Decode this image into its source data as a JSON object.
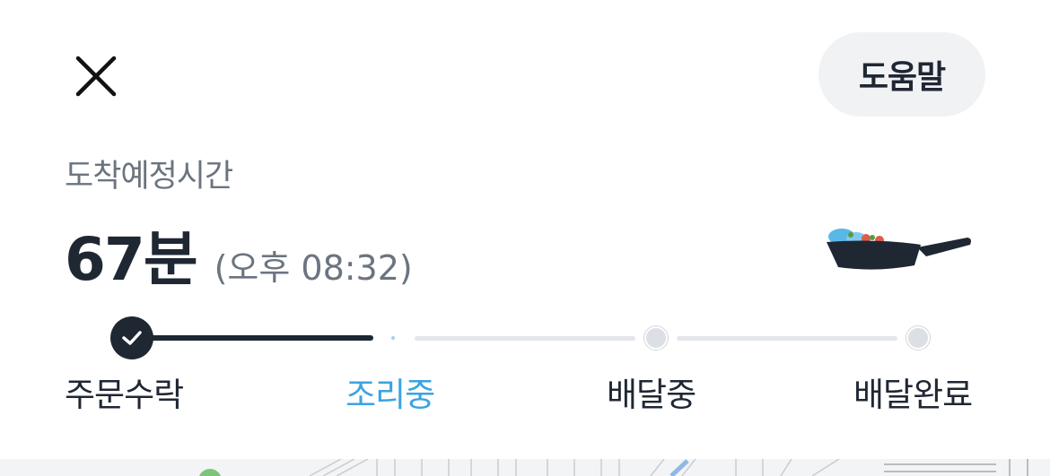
{
  "header": {
    "close_icon": "close-icon",
    "help_label": "도움말"
  },
  "eta": {
    "label": "도착예정시간",
    "minutes": "67분",
    "clock": "(오후 08:32)"
  },
  "status_icon": "frying-pan-icon",
  "progress": {
    "current_step": 2,
    "steps": [
      {
        "label": "주문수락",
        "state": "done"
      },
      {
        "label": "조리중",
        "state": "active"
      },
      {
        "label": "배달중",
        "state": "pending"
      },
      {
        "label": "배달완료",
        "state": "pending"
      }
    ]
  },
  "colors": {
    "text_primary": "#1f2733",
    "text_secondary": "#6b7480",
    "active": "#3aa3e0",
    "pending": "#e3e6ea",
    "help_bg": "#f1f2f4"
  }
}
